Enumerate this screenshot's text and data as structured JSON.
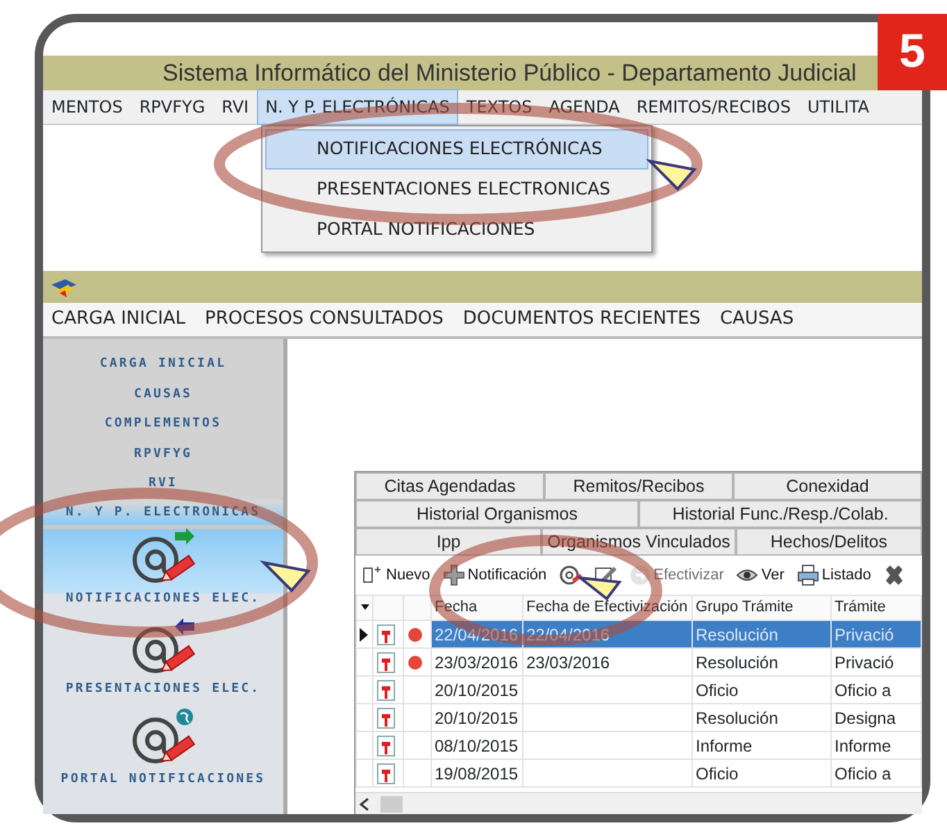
{
  "badge": "5",
  "main_window": {
    "title": "Sistema Informático del Ministerio Público  - Departamento Judicial",
    "menu": [
      {
        "label": "MENTOS",
        "selected": false
      },
      {
        "label": "RPVFYG",
        "selected": false
      },
      {
        "label": "RVI",
        "selected": false
      },
      {
        "label": "N. Y P. ELECTRÓNICAS",
        "selected": true
      },
      {
        "label": "TEXTOS",
        "selected": false
      },
      {
        "label": "AGENDA",
        "selected": false
      },
      {
        "label": "REMITOS/RECIBOS",
        "selected": false
      },
      {
        "label": "UTILITA",
        "selected": false
      }
    ],
    "dropdown": [
      {
        "label": "NOTIFICACIONES ELECTRÓNICAS",
        "selected": true
      },
      {
        "label": "PRESENTACIONES ELECTRONICAS",
        "selected": false
      },
      {
        "label": "PORTAL NOTIFICACIONES",
        "selected": false
      }
    ]
  },
  "child_window": {
    "menu": [
      "CARGA INICIAL",
      "PROCESOS CONSULTADOS",
      "DOCUMENTOS RECIENTES",
      "CAUSAS"
    ],
    "sidebar": {
      "links": [
        "CARGA INICIAL",
        "CAUSAS",
        "COMPLEMENTOS",
        "RPVFYG",
        "RVI"
      ],
      "section": {
        "label": "N. Y P.  ELECTRONICAS",
        "items": [
          {
            "label": "NOTIFICACIONES ELEC.",
            "kind": "send",
            "selected": true
          },
          {
            "label": "PRESENTACIONES ELEC.",
            "kind": "receive",
            "selected": false
          },
          {
            "label": "PORTAL NOTIFICACIONES",
            "kind": "portal",
            "selected": false
          }
        ]
      }
    }
  },
  "tabs": [
    [
      "Citas Agendadas",
      "Remitos/Recibos",
      "Conexidad"
    ],
    [
      "Historial Organismos",
      "Historial Func./Resp./Colab."
    ],
    [
      "Ipp",
      "Organismos Vinculados",
      "Hechos/Delitos"
    ]
  ],
  "toolbar": [
    {
      "kind": "new",
      "label": "Nuevo",
      "disabled": false
    },
    {
      "kind": "add",
      "label": "Notificación",
      "disabled": false
    },
    {
      "kind": "at",
      "disabled": false
    },
    {
      "kind": "edit",
      "disabled": false
    },
    {
      "kind": "go",
      "label": "Efectivizar",
      "disabled": true
    },
    {
      "kind": "view",
      "label": "Ver",
      "disabled": false
    },
    {
      "kind": "print",
      "label": "Listado",
      "disabled": false
    },
    {
      "kind": "delete",
      "disabled": false
    }
  ],
  "grid": {
    "columns": [
      "Fecha",
      "Fecha de Efectivización",
      "Grupo Trámite",
      "Trámite"
    ],
    "rows": [
      {
        "selected": true,
        "flagged": true,
        "cells": [
          "22/04/2016",
          "22/04/2016",
          "Resolución",
          "Privació"
        ]
      },
      {
        "selected": false,
        "flagged": true,
        "cells": [
          "23/03/2016",
          "23/03/2016",
          "Resolución",
          "Privació"
        ]
      },
      {
        "selected": false,
        "flagged": false,
        "cells": [
          "20/10/2015",
          "",
          "Oficio",
          "Oficio a"
        ]
      },
      {
        "selected": false,
        "flagged": false,
        "cells": [
          "20/10/2015",
          "",
          "Resolución",
          "Designa"
        ]
      },
      {
        "selected": false,
        "flagged": false,
        "cells": [
          "08/10/2015",
          "",
          "Informe",
          "Informe"
        ]
      },
      {
        "selected": false,
        "flagged": false,
        "cells": [
          "19/08/2015",
          "",
          "Oficio",
          "Oficio a"
        ]
      }
    ]
  }
}
